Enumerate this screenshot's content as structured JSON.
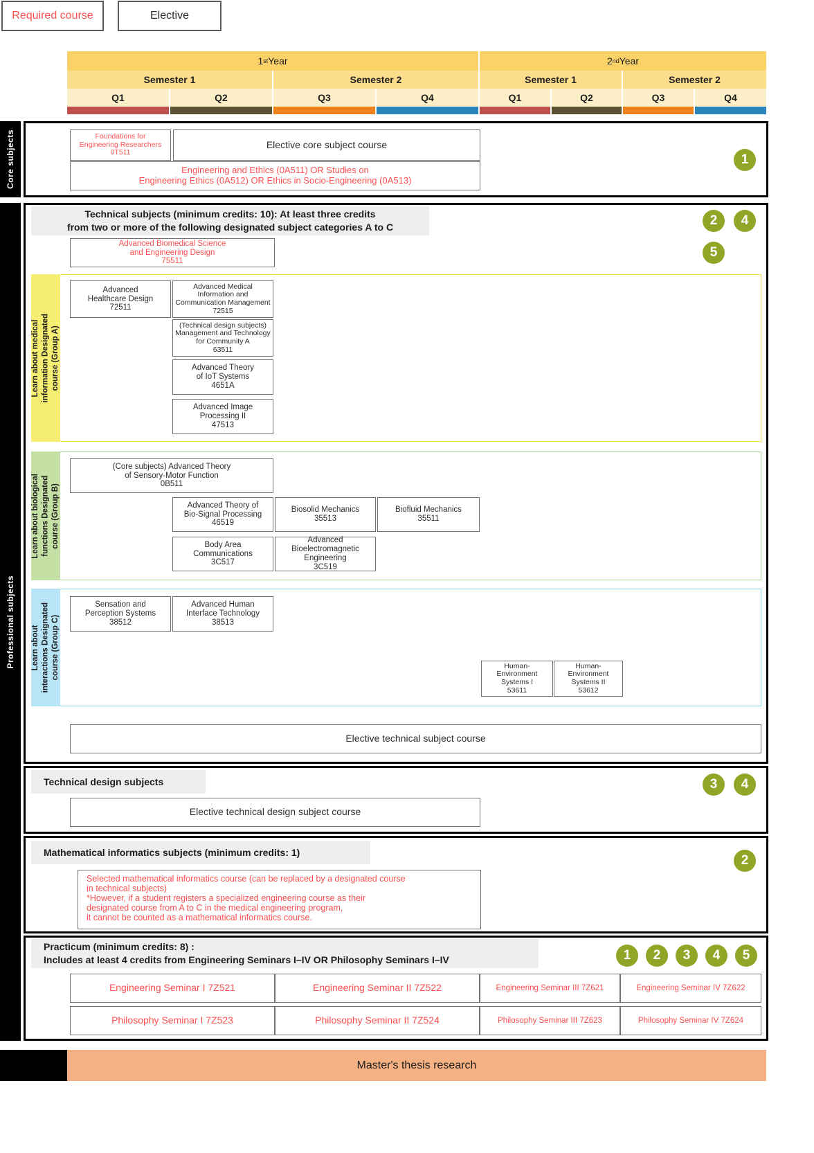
{
  "legend": {
    "required_label": "Required course",
    "elective_label": "Elective",
    "required_color": "#fa5050",
    "elective_color": "#2b2b2b"
  },
  "timeline": {
    "years": [
      {
        "label": "1st Year",
        "sup": "st",
        "base": "1",
        "tail": " Year"
      },
      {
        "label": "2nd Year",
        "sup": "nd",
        "base": "2",
        "tail": " Year"
      }
    ],
    "semesters": [
      "Semester 1",
      "Semester 2",
      "Semester 1",
      "Semester 2"
    ],
    "quarters": [
      "Q1",
      "Q2",
      "Q3",
      "Q4",
      "Q1",
      "Q2",
      "Q3",
      "Q4"
    ],
    "quarter_colors": [
      "#c0504d",
      "#5b5233",
      "#f0821e",
      "#2b85bb",
      "#c0504d",
      "#5b5233",
      "#f0821e",
      "#2b85bb"
    ]
  },
  "sections": {
    "core": {
      "spine_label": "Core subjects",
      "boxes": {
        "foundations": "Foundations for\nEngineering Researchers\n0T511",
        "elective_core": "Elective core subject course",
        "ethics": "Engineering and Ethics (0A511) OR Studies on\nEngineering Ethics (0A512) OR Ethics in Socio-Engineering (0A513)"
      }
    },
    "professional": {
      "spine_label": "Professional subjects",
      "technical": {
        "banner": "Technical subjects (minimum credits: 10): At least three credits\nfrom two or more of the following designated subject categories A to C",
        "markers": [
          "2",
          "4",
          "5"
        ],
        "top_course": "Advanced Biomedical Science\nand Engineering Design\n75511",
        "elective_course": "Elective technical subject course",
        "groups": [
          {
            "id": "A",
            "tab_label": "Learn about medical\ninformation Designated\ncourse (Group A)",
            "tab_color": "#f6ee72",
            "border_color": "#f2e14a",
            "courses": [
              {
                "name": "Advanced\nHealthcare Design\n72511"
              },
              {
                "name": "Advanced Medical\nInformation and\nCommunication Management\n72515"
              },
              {
                "name": "(Technical design subjects)\nManagement and Technology\nfor Community A\n63511"
              },
              {
                "name": "Advanced Theory\nof IoT Systems\n4651A"
              },
              {
                "name": "Advanced Image\nProcessing II\n47513"
              }
            ]
          },
          {
            "id": "B",
            "tab_label": "Learn about biological\nfunctions Designated\ncourse (Group B)",
            "tab_color": "#c5e0a5",
            "border_color": "#a9d18e",
            "courses": [
              {
                "name": "(Core subjects)  Advanced Theory\nof Sensory-Motor Function\n0B511"
              },
              {
                "name": "Advanced Theory of\nBio-Signal Processing\n46519"
              },
              {
                "name": "Biosolid Mechanics\n35513"
              },
              {
                "name": "Biofluid Mechanics\n35511"
              },
              {
                "name": "Body Area\nCommunications\n3C517"
              },
              {
                "name": "Advanced\nBioelectromagnetic\nEngineering\n3C519"
              }
            ]
          },
          {
            "id": "C",
            "tab_label": "Learn about\ninteractions Designated\ncourse (Group C)",
            "tab_color": "#b7e4f7",
            "border_color": "#8fd5f0",
            "courses": [
              {
                "name": "Sensation and\nPerception Systems\n38512"
              },
              {
                "name": "Advanced Human\nInterface Technology\n38513"
              },
              {
                "name": "Human-\nEnvironment\nSystems I\n53611"
              },
              {
                "name": "Human-\nEnvironment\nSystems II\n53612"
              }
            ]
          }
        ]
      },
      "technical_design": {
        "banner": "Technical design subjects",
        "markers": [
          "3",
          "4"
        ],
        "elective_course": "Elective technical design subject course"
      },
      "math_informatics": {
        "banner": "Mathematical informatics subjects (minimum credits: 1)",
        "markers": [
          "2"
        ],
        "note": "Selected mathematical informatics course (can be replaced by a designated course\nin technical subjects)\n*However, if a student registers a specialized engineering course as their\ndesignated course from A to C in the medical engineering program,\nit cannot be counted as a mathematical informatics course."
      },
      "practicum": {
        "banner": "Practicum (minimum credits: 8) :\nIncludes at least 4 credits from Engineering Seminars I–IV OR Philosophy Seminars I–IV",
        "markers": [
          "1",
          "2",
          "3",
          "4",
          "5"
        ],
        "rows": [
          [
            "Engineering Seminar I 7Z521",
            "Engineering Seminar II 7Z522",
            "Engineering Seminar III 7Z621",
            "Engineering Seminar IV 7Z622"
          ],
          [
            "Philosophy Seminar I 7Z523",
            "Philosophy Seminar II 7Z524",
            "Philosophy Seminar III 7Z623",
            "Philosophy Seminar IV 7Z624"
          ]
        ]
      }
    },
    "thesis": {
      "label": "Master's thesis research",
      "color": "#f5b183"
    }
  }
}
